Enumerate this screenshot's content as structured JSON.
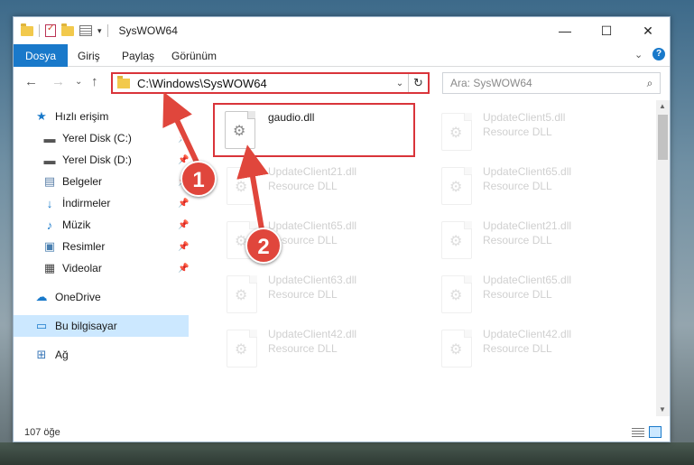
{
  "window": {
    "title": "SysWOW64",
    "controls": {
      "minimize": "—",
      "maximize": "☐",
      "close": "✕"
    }
  },
  "ribbon": {
    "tabs": [
      {
        "label": "Dosya",
        "active": true
      },
      {
        "label": "Giriş",
        "active": false
      },
      {
        "label": "Paylaş",
        "active": false
      },
      {
        "label": "Görünüm",
        "active": false
      }
    ],
    "help": "?"
  },
  "address_bar": {
    "path": "C:\\Windows\\SysWOW64",
    "search_placeholder": "Ara: SysWOW64"
  },
  "sidebar": {
    "items": [
      {
        "label": "Hızlı erişim",
        "icon": "star-icon"
      },
      {
        "label": "Yerel Disk (C:)",
        "icon": "drive-icon",
        "pinned": true
      },
      {
        "label": "Yerel Disk (D:)",
        "icon": "drive-icon",
        "pinned": true
      },
      {
        "label": "Belgeler",
        "icon": "documents-icon",
        "pinned": true
      },
      {
        "label": "İndirmeler",
        "icon": "download-icon",
        "pinned": true
      },
      {
        "label": "Müzik",
        "icon": "music-icon",
        "pinned": true
      },
      {
        "label": "Resimler",
        "icon": "pictures-icon",
        "pinned": true
      },
      {
        "label": "Videolar",
        "icon": "video-icon",
        "pinned": true
      },
      {
        "label": "OneDrive",
        "icon": "cloud-icon"
      },
      {
        "label": "Bu bilgisayar",
        "icon": "computer-icon",
        "selected": true
      },
      {
        "label": "Ağ",
        "icon": "network-icon"
      }
    ]
  },
  "files": [
    {
      "name": "gaudio.dll",
      "type": ""
    },
    {
      "name": "UpdateClient5.dll",
      "type": "Resource DLL"
    },
    {
      "name": "UpdateClient21.dll",
      "type": "Resource DLL"
    },
    {
      "name": "UpdateClient65.dll",
      "type": "Resource DLL"
    },
    {
      "name": "UpdateClient65.dll",
      "type": "Resource DLL"
    },
    {
      "name": "UpdateClient21.dll",
      "type": "Resource DLL"
    },
    {
      "name": "UpdateClient63.dll",
      "type": "Resource DLL"
    },
    {
      "name": "UpdateClient65.dll",
      "type": "Resource DLL"
    },
    {
      "name": "UpdateClient42.dll",
      "type": "Resource DLL"
    },
    {
      "name": "UpdateClient42.dll",
      "type": "Resource DLL"
    }
  ],
  "status": {
    "item_count": "107 öğe"
  },
  "callouts": [
    {
      "number": "1"
    },
    {
      "number": "2"
    }
  ],
  "colors": {
    "accent": "#1979ca",
    "highlight": "#d9343a",
    "callout": "#e0463c",
    "selection": "#cce8ff"
  }
}
